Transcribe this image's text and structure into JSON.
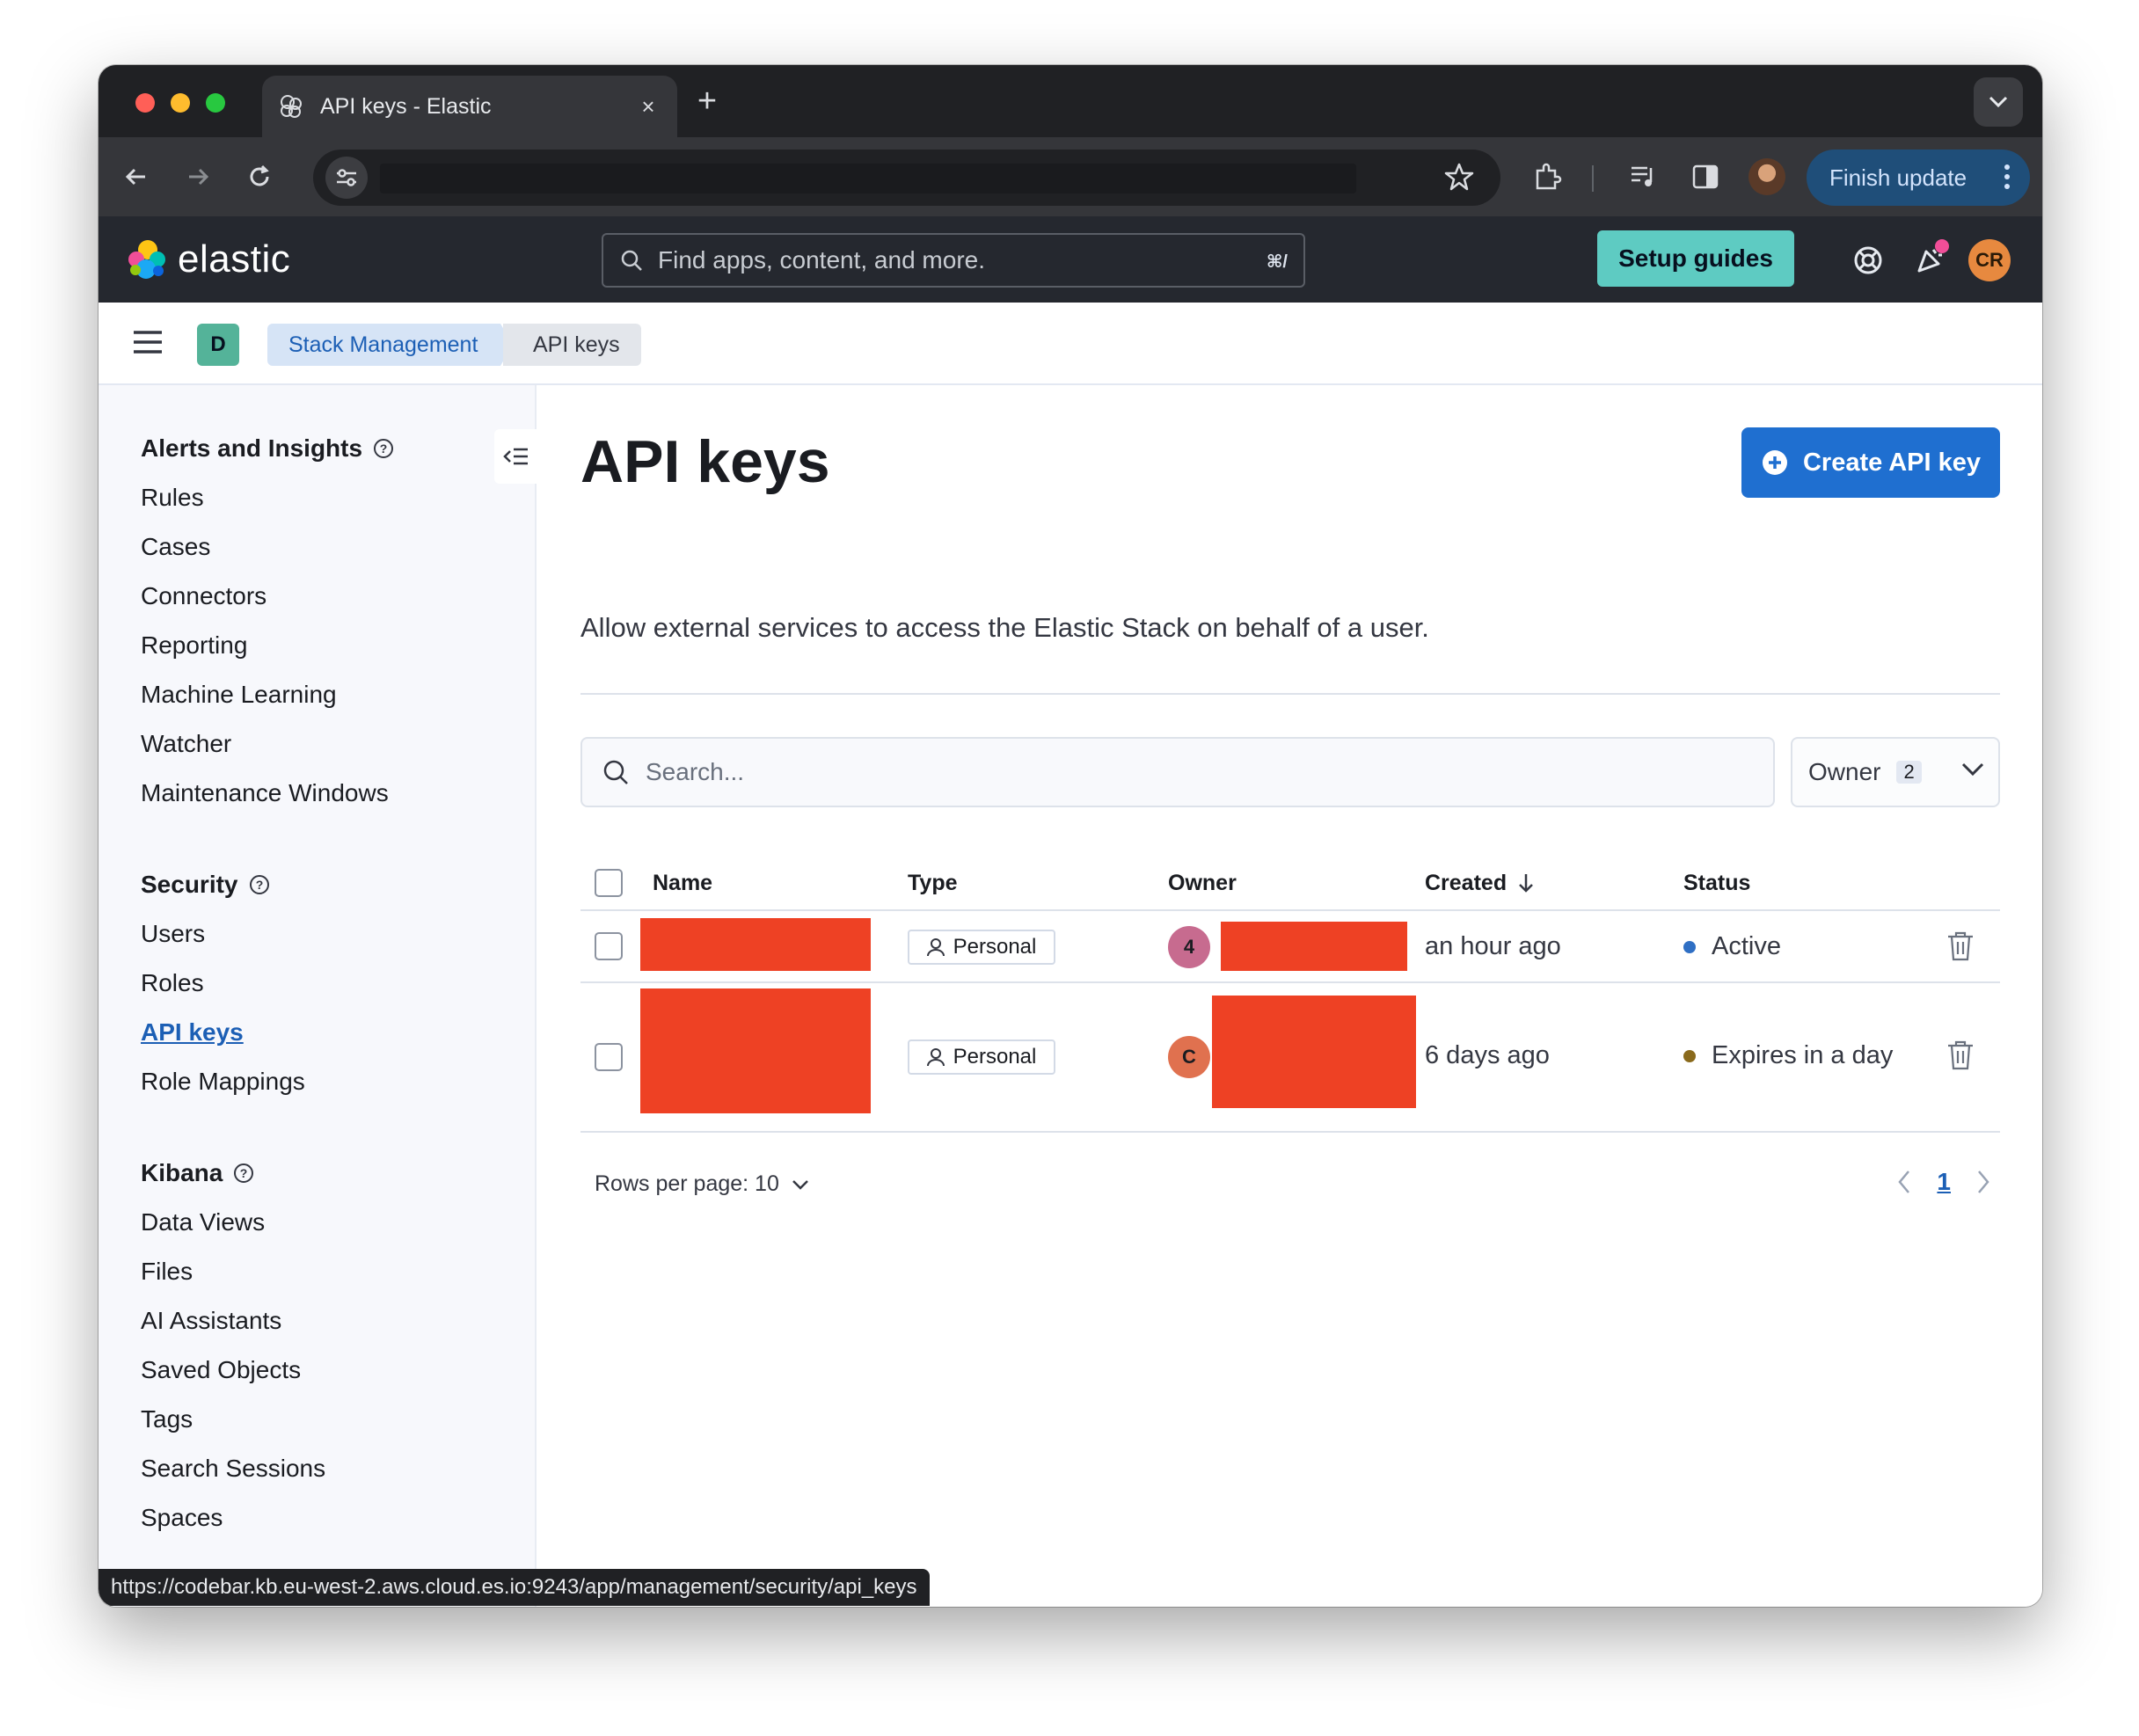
{
  "browser": {
    "tab_title": "API keys - Elastic",
    "tab_close": "×",
    "new_tab": "+",
    "finish_update": "Finish update",
    "status_url": "https://codebar.kb.eu-west-2.aws.cloud.es.io:9243/app/management/security/api_keys"
  },
  "header": {
    "logo_text": "elastic",
    "search_placeholder": "Find apps, content, and more.",
    "search_shortcut": "⌘/",
    "setup_guides": "Setup guides",
    "user_initials": "CR"
  },
  "breadcrumbs": {
    "space_initial": "D",
    "items": [
      "Stack Management",
      "API keys"
    ]
  },
  "sidebar": {
    "groups": [
      {
        "title": "Alerts and Insights",
        "items": [
          "Rules",
          "Cases",
          "Connectors",
          "Reporting",
          "Machine Learning",
          "Watcher",
          "Maintenance Windows"
        ]
      },
      {
        "title": "Security",
        "items": [
          "Users",
          "Roles",
          "API keys",
          "Role Mappings"
        ]
      },
      {
        "title": "Kibana",
        "items": [
          "Data Views",
          "Files",
          "AI Assistants",
          "Saved Objects",
          "Tags",
          "Search Sessions",
          "Spaces"
        ]
      }
    ],
    "active_item": "API keys"
  },
  "main": {
    "title": "API keys",
    "create_button": "Create API key",
    "description": "Allow external services to access the Elastic Stack on behalf of a user.",
    "search_placeholder": "Search...",
    "owner_filter": {
      "label": "Owner",
      "count": "2"
    },
    "table": {
      "columns": [
        "Name",
        "Type",
        "Owner",
        "Created",
        "Status"
      ],
      "rows": [
        {
          "type": "Personal",
          "owner_initial": "4",
          "created": "an hour ago",
          "status": "Active"
        },
        {
          "type": "Personal",
          "owner_initial": "C",
          "created": "6 days ago",
          "status": "Expires in a day"
        }
      ]
    },
    "pagination": {
      "rows_per_page": "Rows per page: 10",
      "current_page": "1"
    }
  },
  "colors": {
    "active_status": "#2f6fc4",
    "expiring_status": "#8a6a1c",
    "owner_avatar_1": "#c76b8f",
    "owner_avatar_2": "#e0714f",
    "redaction": "#ee4124",
    "primary": "#1f6fd0"
  }
}
